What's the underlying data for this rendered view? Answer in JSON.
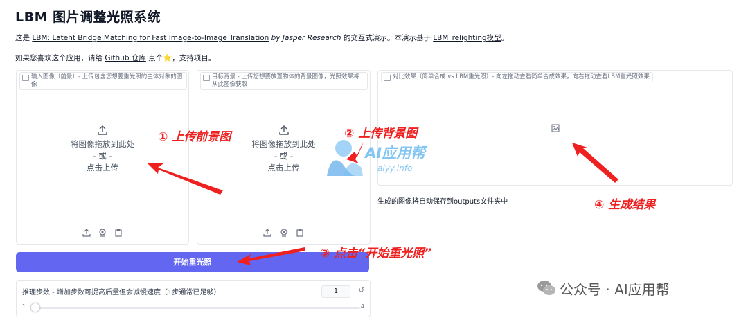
{
  "app": {
    "title": "LBM 图片调整光照系统"
  },
  "intro": {
    "prefix": "这是 ",
    "paper_link": "LBM: Latent Bridge Matching for Fast Image-to-Image Translation",
    "by": " by Jasper Research",
    "middle": " 的交互式演示。本演示基于 ",
    "model_link": "LBM_relighting模型",
    "suffix": "。",
    "line2_prefix": "如果您喜欢这个应用，请给 ",
    "github_link": "Github 仓库",
    "line2_middle": " 点个",
    "star_icon": "⭐",
    "line2_suffix": "，支持项目。"
  },
  "panels": {
    "foreground": {
      "label": "输入图像（前景）- 上传包含您想要重光照的主体对象的图像",
      "drop_text": "将图像拖放到此处",
      "or_text": "- 或 -",
      "click_text": "点击上传",
      "tools": [
        "upload-icon",
        "webcam-icon",
        "clipboard-icon"
      ]
    },
    "background": {
      "label": "目标背景 - 上传您想要放置物体的背景图像，光照效果将从此图像获取",
      "drop_text": "将图像拖放到此处",
      "or_text": "- 或 -",
      "click_text": "点击上传",
      "tools": [
        "upload-icon",
        "webcam-icon",
        "clipboard-icon"
      ]
    },
    "result": {
      "label": "对比效果（简单合成 vs LBM重光照）- 向左拖动查看简单合成效果，向右拖动查看LBM重光照效果",
      "icon": "image-icon"
    }
  },
  "result_note": "生成的图像将自动保存到outputs文件夹中",
  "run_button": "开始重光照",
  "slider": {
    "label": "推理步数 - 增加步数可提高质量但会减慢速度（1步通常已足够）",
    "value": "1",
    "min": "1",
    "max": "4",
    "reset_icon": "↺"
  },
  "annotations": {
    "step1": "① 上传前景图",
    "step2": "② 上传背景图",
    "step3": "③ 点击“开始重光照”",
    "step4": "④ 生成结果",
    "color": "#ef2020"
  },
  "watermark": {
    "text": "AI应用帮",
    "url": "aiyy.info",
    "wechat": "公众号 · AI应用帮"
  },
  "colors": {
    "accent": "#6366f1",
    "border": "#e5e7eb"
  }
}
